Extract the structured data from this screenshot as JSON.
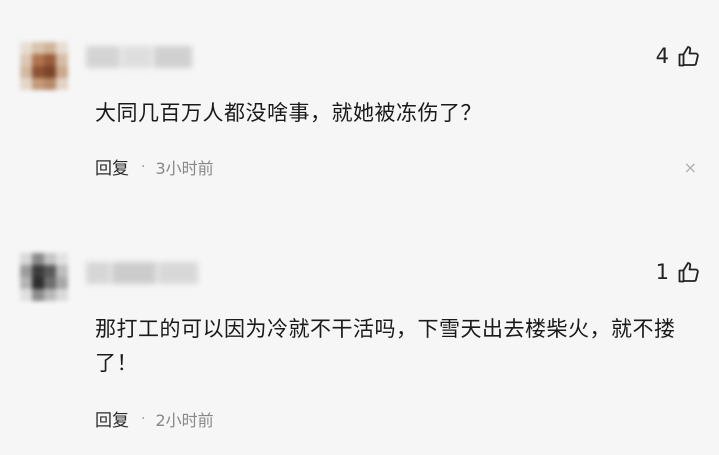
{
  "comments": [
    {
      "likes": "4",
      "text": "大同几百万人都没啥事，就她被冻伤了？",
      "reply_label": "回复",
      "separator": "·",
      "time": "3小时前",
      "close_symbol": "×"
    },
    {
      "likes": "1",
      "text": "那打工的可以因为冷就不干活吗，下雪天出去楼柴火，就不搂了！",
      "reply_label": "回复",
      "separator": "·",
      "time": "2小时前"
    }
  ],
  "colors": {
    "background": "#f6f6f6",
    "text": "#1a1a1a",
    "meta": "#888888",
    "avatar1": [
      "#d9c4b0",
      "#a0674a",
      "#7a4a33",
      "#e6d9cc"
    ],
    "avatar2": [
      "#cfcfcf",
      "#6b6b6b",
      "#3a3a3a",
      "#9a9a9a"
    ]
  },
  "icons": {
    "like": "thumbs-up-icon",
    "close": "close-icon"
  }
}
